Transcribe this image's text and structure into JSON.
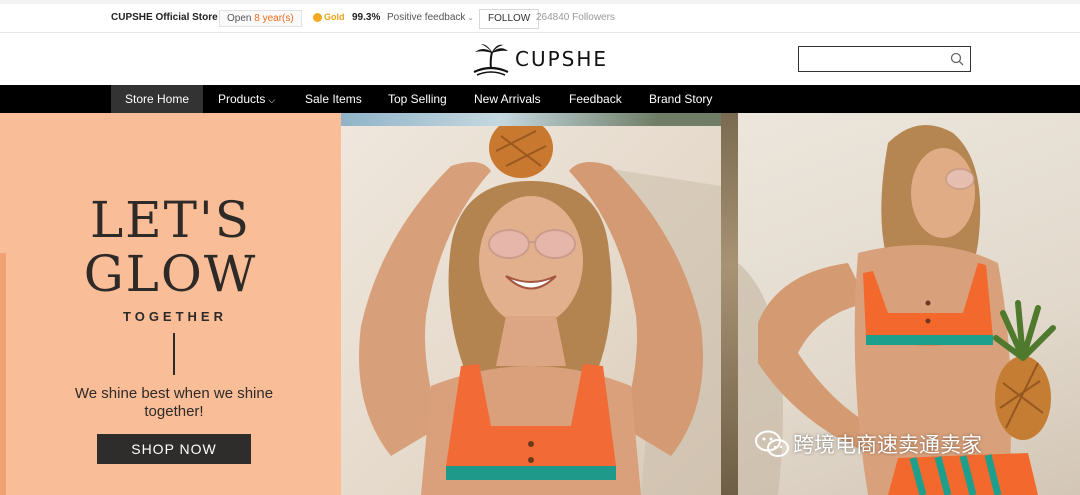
{
  "topbar": {
    "store_name": "CUPSHE Official Store",
    "open_prefix": "Open ",
    "open_years": "8 year(s)",
    "gold_label": "Gold",
    "rating": "99.3%",
    "feedback_label": "Positive feedback",
    "follow_label": "FOLLOW",
    "followers": "264840 Followers"
  },
  "brand": {
    "logo_text": "CUPSHE",
    "search_placeholder": ""
  },
  "nav": {
    "items": [
      {
        "label": "Store Home",
        "active": true
      },
      {
        "label": "Products",
        "has_dropdown": true
      },
      {
        "label": "Sale Items"
      },
      {
        "label": "Top Selling"
      },
      {
        "label": "New Arrivals"
      },
      {
        "label": "Feedback"
      },
      {
        "label": "Brand Story"
      }
    ]
  },
  "hero": {
    "headline_line1": "LET'S",
    "headline_line2": "GLOW",
    "subheadline": "TOGETHER",
    "tagline": "We shine best when we shine together!",
    "cta_label": "SHOP NOW"
  },
  "watermark": {
    "text": "跨境电商速卖通卖家",
    "icon": "wechat-icon"
  },
  "colors": {
    "accent_orange": "#f26a1b",
    "gold": "#e8a317",
    "nav_bg": "#000000",
    "hero_peach": "#f9bd98",
    "cta_bg": "#2f2d2c"
  }
}
